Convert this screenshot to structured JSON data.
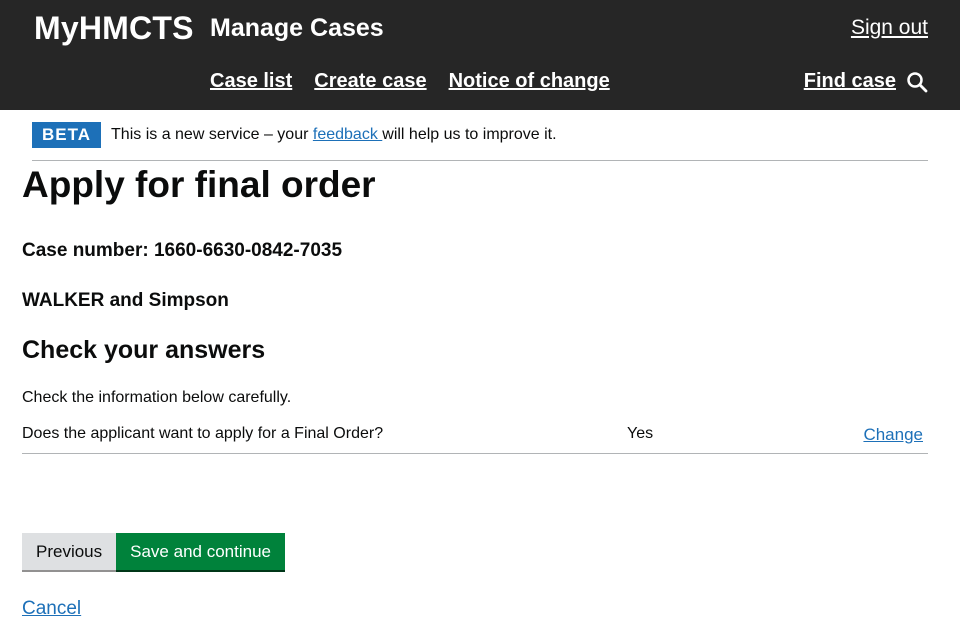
{
  "header": {
    "brand": "MyHMCTS",
    "service": "Manage Cases",
    "sign_out": "Sign out",
    "nav": [
      "Case list",
      "Create case",
      "Notice of change"
    ],
    "find_case": "Find case",
    "find_case_icon": "search-icon"
  },
  "phase_banner": {
    "tag": "BETA",
    "text_before": "This is a new service – your ",
    "link": "feedback ",
    "text_after": "will help us to improve it."
  },
  "page": {
    "title": "Apply for final order",
    "case_number": "Case number: 1660-6630-0842-7035",
    "parties": "WALKER and Simpson",
    "section_heading": "Check your answers",
    "hint": "Check the information below carefully."
  },
  "summary": [
    {
      "question": "Does the applicant want to apply for a Final Order?",
      "answer": "Yes",
      "action": "Change"
    }
  ],
  "actions": {
    "previous": "Previous",
    "save": "Save and continue",
    "cancel": "Cancel"
  },
  "colors": {
    "header_bg": "#262626",
    "beta_tag": "#1d70b8",
    "link": "#1d70b8",
    "primary_button": "#00823b",
    "secondary_button": "#dee0e2"
  }
}
